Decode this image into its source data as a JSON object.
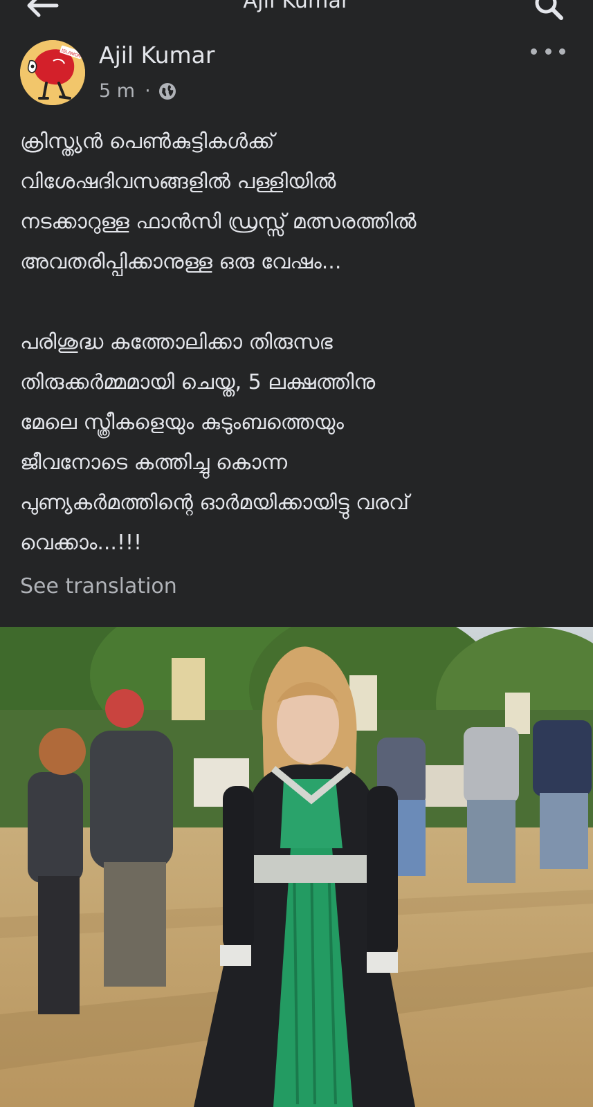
{
  "topbar": {
    "title": "Ajil Kumar",
    "back_icon": "arrow-left-icon",
    "search_icon": "search-icon"
  },
  "post": {
    "author": "Ajil Kumar",
    "time": "5 m",
    "separator": "·",
    "audience_icon": "globe-icon",
    "more_icon": "more-horizontal-icon",
    "avatar_caption": "ISLAMON",
    "body": "ക്രിസ്ത്യൻ പെൺകുട്ടികൾക്ക്\nവിശേഷദിവസങ്ങളിൽ പള്ളിയിൽ\nനടക്കാറുള്ള ഫാൻസി ഡ്രസ്സ് മത്സരത്തിൽ\nഅവതരിപ്പിക്കാനുള്ള ഒരു വേഷം...\n\nപരിശുദ്ധ കത്തോലിക്കാ തിരുസഭ\nതിരുക്കർമ്മമായി ചെയ്ത, 5 ലക്ഷത്തിനു\nമേലെ സ്ത്രീകളെയും കുടുംബത്തെയും\nജീവനോടെ കത്തിച്ചു കൊന്ന\nപുണ്യകർമത്തിന്റെ ഓർമയിക്കായിട്ടു വരവ്\nവെക്കാം...!!!",
    "see_translation": "See translation"
  },
  "colors": {
    "background": "#242526",
    "text_primary": "#e4e6eb",
    "text_secondary": "#b0b3b8"
  }
}
